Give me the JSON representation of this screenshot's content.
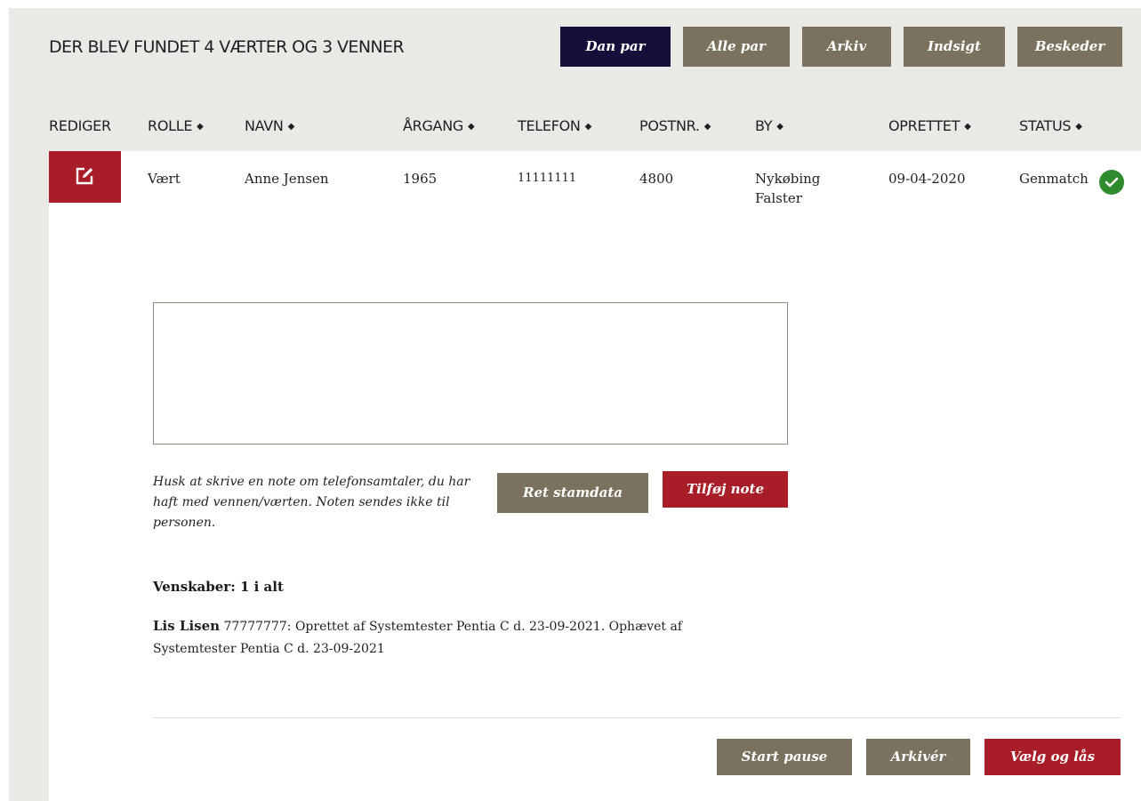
{
  "header": {
    "title": "DER BLEV FUNDET 4 VÆRTER OG 3 VENNER",
    "nav_buttons": [
      "Dan par",
      "Alle par",
      "Arkiv",
      "Indsigt",
      "Beskeder"
    ]
  },
  "table": {
    "columns": [
      "REDIGER",
      "ROLLE",
      "NAVN",
      "ÅRGANG",
      "TELEFON",
      "POSTNR.",
      "BY",
      "OPRETTET",
      "STATUS"
    ],
    "row": {
      "rolle": "Vært",
      "navn": "Anne Jensen",
      "aargang": "1965",
      "telefon": "11111111",
      "postnr": "4800",
      "by": "Nykøbing Falster",
      "oprettet": "09-04-2020",
      "status": "Genmatch",
      "status_icon": "check-circle-icon"
    }
  },
  "note": {
    "value": "",
    "hint": "Husk at skrive en note om telefonsamtaler, du har haft med vennen/værten. Noten sendes ikke til personen.",
    "edit_button": "Ret stamdata",
    "add_button": "Tilføj note"
  },
  "friendships": {
    "title": "Venskaber: 1 i alt",
    "items": [
      {
        "name": "Lis Lisen",
        "phone": "77777777",
        "text": "Oprettet af Systemtester Pentia C d. 23-09-2021. Ophævet af Systemtester Pentia C d. 23-09-2021"
      }
    ]
  },
  "footer": {
    "start_pause": "Start pause",
    "archive": "Arkivér",
    "choose_lock": "Vælg og lås"
  },
  "colors": {
    "panel_bg": "#e9e9e6",
    "navy": "#15103a",
    "taupe": "#7b715f",
    "red": "#a81d27",
    "green": "#2e8b2e"
  }
}
